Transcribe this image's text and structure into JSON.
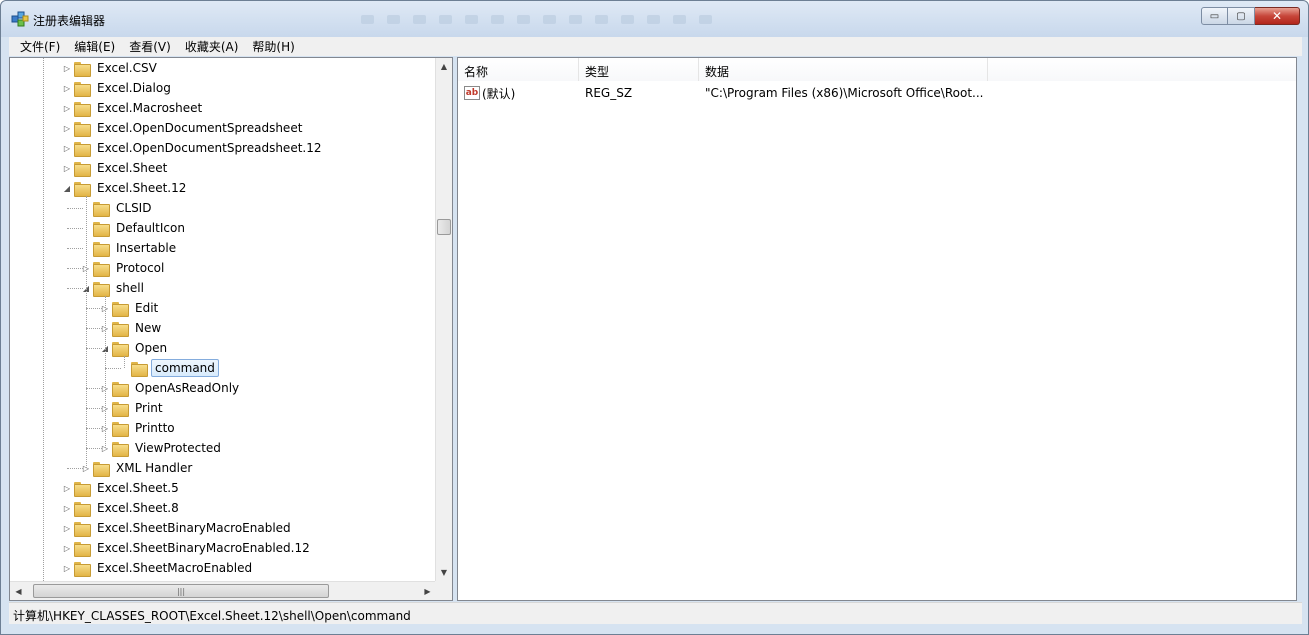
{
  "window": {
    "title": "注册表编辑器",
    "caption": {
      "minimize": "▭",
      "maximize": "▢",
      "close": "✕"
    }
  },
  "menu": [
    "文件(F)",
    "编辑(E)",
    "查看(V)",
    "收藏夹(A)",
    "帮助(H)"
  ],
  "tree": {
    "items": [
      {
        "label": "Excel.CSV",
        "level": 0,
        "expander": "collapsed"
      },
      {
        "label": "Excel.Dialog",
        "level": 0,
        "expander": "collapsed"
      },
      {
        "label": "Excel.Macrosheet",
        "level": 0,
        "expander": "collapsed"
      },
      {
        "label": "Excel.OpenDocumentSpreadsheet",
        "level": 0,
        "expander": "collapsed"
      },
      {
        "label": "Excel.OpenDocumentSpreadsheet.12",
        "level": 0,
        "expander": "collapsed"
      },
      {
        "label": "Excel.Sheet",
        "level": 0,
        "expander": "collapsed"
      },
      {
        "label": "Excel.Sheet.12",
        "level": 0,
        "expander": "expanded"
      },
      {
        "label": "CLSID",
        "level": 1,
        "expander": "none"
      },
      {
        "label": "DefaultIcon",
        "level": 1,
        "expander": "none"
      },
      {
        "label": "Insertable",
        "level": 1,
        "expander": "none"
      },
      {
        "label": "Protocol",
        "level": 1,
        "expander": "collapsed"
      },
      {
        "label": "shell",
        "level": 1,
        "expander": "expanded"
      },
      {
        "label": "Edit",
        "level": 2,
        "expander": "collapsed"
      },
      {
        "label": "New",
        "level": 2,
        "expander": "collapsed"
      },
      {
        "label": "Open",
        "level": 2,
        "expander": "expanded"
      },
      {
        "label": "command",
        "level": 3,
        "expander": "none",
        "selected": true
      },
      {
        "label": "OpenAsReadOnly",
        "level": 2,
        "expander": "collapsed"
      },
      {
        "label": "Print",
        "level": 2,
        "expander": "collapsed"
      },
      {
        "label": "Printto",
        "level": 2,
        "expander": "collapsed"
      },
      {
        "label": "ViewProtected",
        "level": 2,
        "expander": "collapsed"
      },
      {
        "label": "XML Handler",
        "level": 1,
        "expander": "collapsed"
      },
      {
        "label": "Excel.Sheet.5",
        "level": 0,
        "expander": "collapsed"
      },
      {
        "label": "Excel.Sheet.8",
        "level": 0,
        "expander": "collapsed"
      },
      {
        "label": "Excel.SheetBinaryMacroEnabled",
        "level": 0,
        "expander": "collapsed"
      },
      {
        "label": "Excel.SheetBinaryMacroEnabled.12",
        "level": 0,
        "expander": "collapsed"
      },
      {
        "label": "Excel.SheetMacroEnabled",
        "level": 0,
        "expander": "collapsed"
      }
    ],
    "hscroll_grip": "|||"
  },
  "list": {
    "columns": {
      "name": "名称",
      "type": "类型",
      "data": "数据"
    },
    "rows": [
      {
        "icon": "ab",
        "name": "(默认)",
        "type": "REG_SZ",
        "data": "\"C:\\Program Files (x86)\\Microsoft Office\\Root..."
      }
    ]
  },
  "status": {
    "path": "计算机\\HKEY_CLASSES_ROOT\\Excel.Sheet.12\\shell\\Open\\command"
  }
}
